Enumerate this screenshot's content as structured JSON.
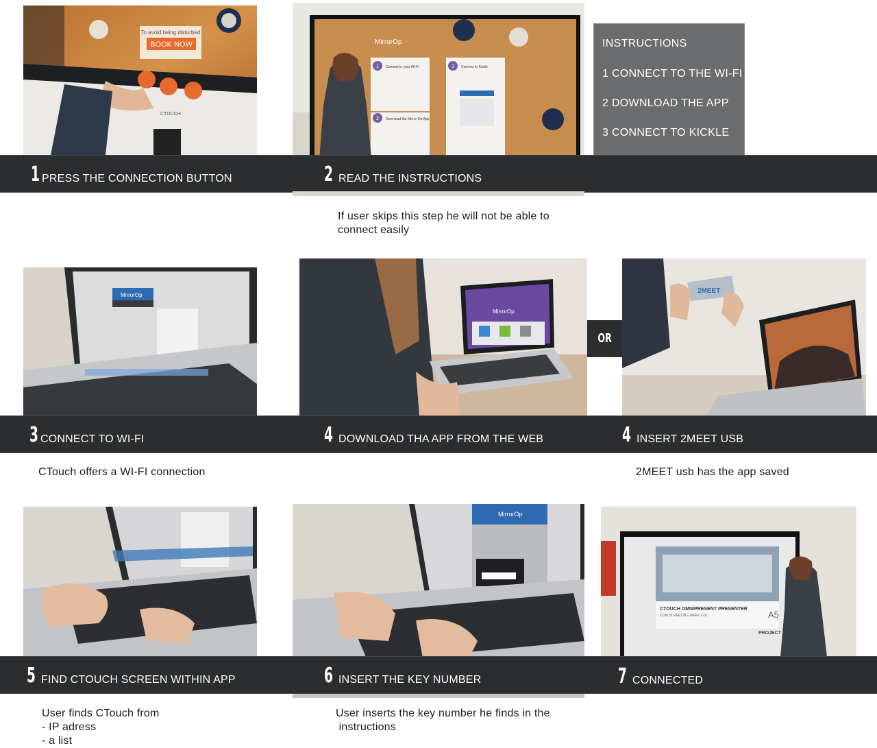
{
  "row1": {
    "step1": {
      "number": "1",
      "label": "PRESS THE CONNECTION BUTTON"
    },
    "step2": {
      "number": "2",
      "label": "READ THE INSTRUCTIONS"
    },
    "caption2": [
      "If user skips this step he will not be able to",
      "connect easily"
    ],
    "instructions": {
      "title": "INSTRUCTIONS",
      "items": [
        "1 CONNECT TO THE WI-FI",
        "2 DOWNLOAD THE APP",
        "3 CONNECT TO KICKLE"
      ]
    },
    "photo1_text": {
      "banner": "To avoid being disturbed",
      "button": "BOOK NOW",
      "brand": "CTOUCH"
    },
    "photo2_text": {
      "brand": "MirrorOp",
      "card1": "Connect to your Wi-Fi",
      "card2": "Download the Mirror-Op App",
      "card3": "Connect to Kickle",
      "n1": "1",
      "n2": "2",
      "n3": "3"
    }
  },
  "row2": {
    "step3": {
      "number": "3",
      "label": "CONNECT TO WI-FI"
    },
    "step4a": {
      "number": "4",
      "label": "DOWNLOAD THA APP FROM THE WEB"
    },
    "step4b": {
      "number": "4",
      "label": "INSERT 2MEET USB"
    },
    "or_label": "OR",
    "caption3": "CTouch offers a WI-FI connection",
    "caption4b": "2MEET usb has the app saved",
    "photo3_text": {
      "brand": "MirrorOp"
    },
    "photo4_text": {
      "brand": "MirrorOp"
    },
    "photo5_text": {
      "usb": "2MEET"
    }
  },
  "row3": {
    "step5": {
      "number": "5",
      "label": "FIND CTOUCH SCREEN WITHIN APP"
    },
    "step6": {
      "number": "6",
      "label": "INSERT THE KEY NUMBER"
    },
    "step7": {
      "number": "7",
      "label": "CONNECTED"
    },
    "caption5": [
      "User finds CTouch from",
      "- IP adress",
      "- a list"
    ],
    "caption6": [
      "User inserts the key number he finds in the",
      " instructions"
    ],
    "photo7_text": {
      "brand": "MirrorOp"
    },
    "photo8_text": {
      "title": "CTOUCH OMNIPRESENT PRESENTER",
      "sub": "COACH MEETING WEEK 3-02",
      "code": "A5",
      "project": "PROJECT"
    }
  },
  "colors": {
    "band": "#2b2d2f",
    "instructions_bg": "#6b6c6e",
    "accent_orange": "#e8692e"
  }
}
